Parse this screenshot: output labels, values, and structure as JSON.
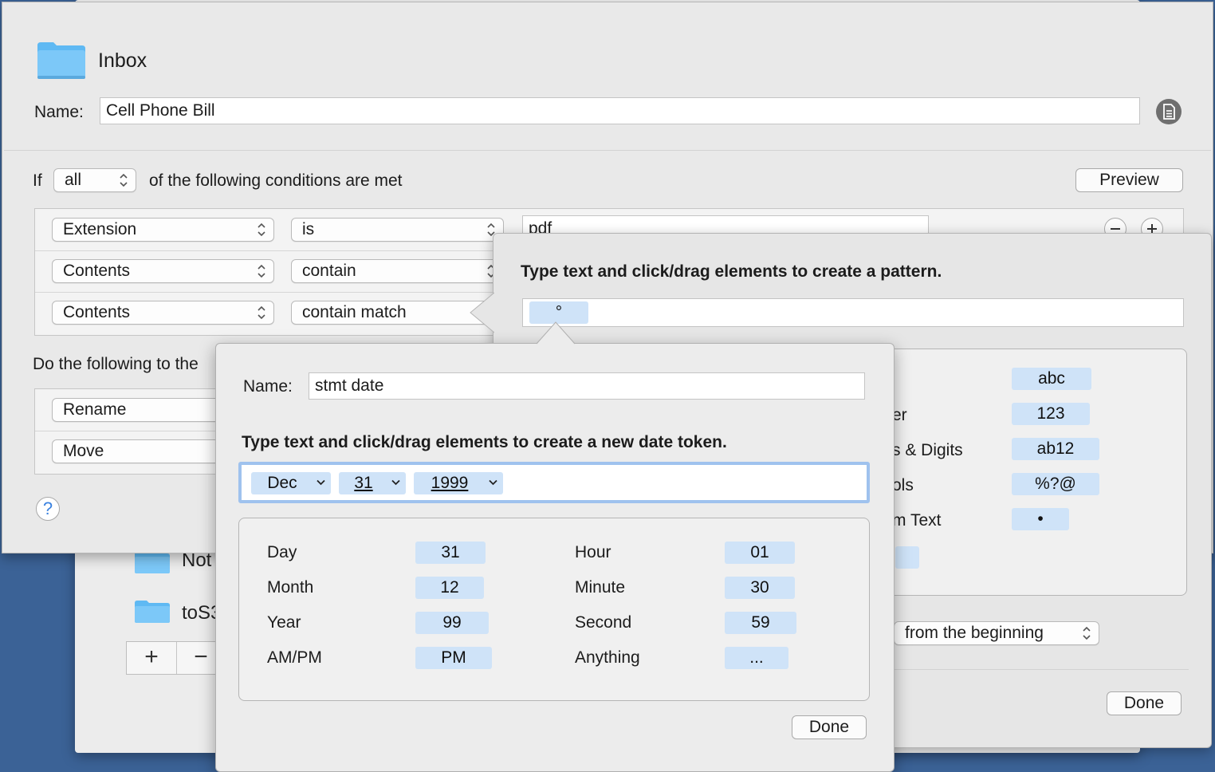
{
  "background_window": {
    "folders": [
      {
        "label": "Not"
      },
      {
        "label": "toS3"
      }
    ],
    "add_label": "+",
    "remove_label": "−"
  },
  "rule": {
    "folder_label": "Inbox",
    "name_label": "Name:",
    "name_value": "Cell Phone Bill",
    "if_label": "If",
    "match_mode": "all",
    "conditions_text": "of the following conditions are met",
    "preview_label": "Preview",
    "conditions": [
      {
        "attribute": "Extension",
        "operator": "is",
        "value": "pdf"
      },
      {
        "attribute": "Contents",
        "operator": "contain"
      },
      {
        "attribute": "Contents",
        "operator": "contain match"
      }
    ],
    "actions_label": "Do the following to the",
    "actions": [
      {
        "action": "Rename"
      },
      {
        "action": "Move"
      }
    ],
    "help_label": "?"
  },
  "pattern_popover": {
    "title": "Type text and click/drag elements to create a pattern.",
    "token": "°",
    "elements": [
      {
        "label": "",
        "token": "abc"
      },
      {
        "label": "er",
        "token": "123"
      },
      {
        "label": "s & Digits",
        "token": "ab12"
      },
      {
        "label": "ols",
        "token": "%?@"
      },
      {
        "label": "m Text",
        "token": "•"
      }
    ],
    "scope_value": "from the beginning",
    "done_label": "Done"
  },
  "date_popover": {
    "name_label": "Name:",
    "name_value": "stmt date",
    "title": "Type text and click/drag elements to create a new date token.",
    "tokens": [
      {
        "value": "Dec"
      },
      {
        "value": "31"
      },
      {
        "value": "1999"
      }
    ],
    "elements_left": [
      {
        "label": "Day",
        "token": "31"
      },
      {
        "label": "Month",
        "token": "12"
      },
      {
        "label": "Year",
        "token": "99"
      },
      {
        "label": "AM/PM",
        "token": "PM"
      }
    ],
    "elements_right": [
      {
        "label": "Hour",
        "token": "01"
      },
      {
        "label": "Minute",
        "token": "30"
      },
      {
        "label": "Second",
        "token": "59"
      },
      {
        "label": "Anything",
        "token": "..."
      }
    ],
    "done_label": "Done"
  },
  "colors": {
    "desktop": "#3b6296",
    "token_fill": "#cfe3f8",
    "focus_ring": "#9fc2ee",
    "folder_blue": "#5fb9f3"
  }
}
